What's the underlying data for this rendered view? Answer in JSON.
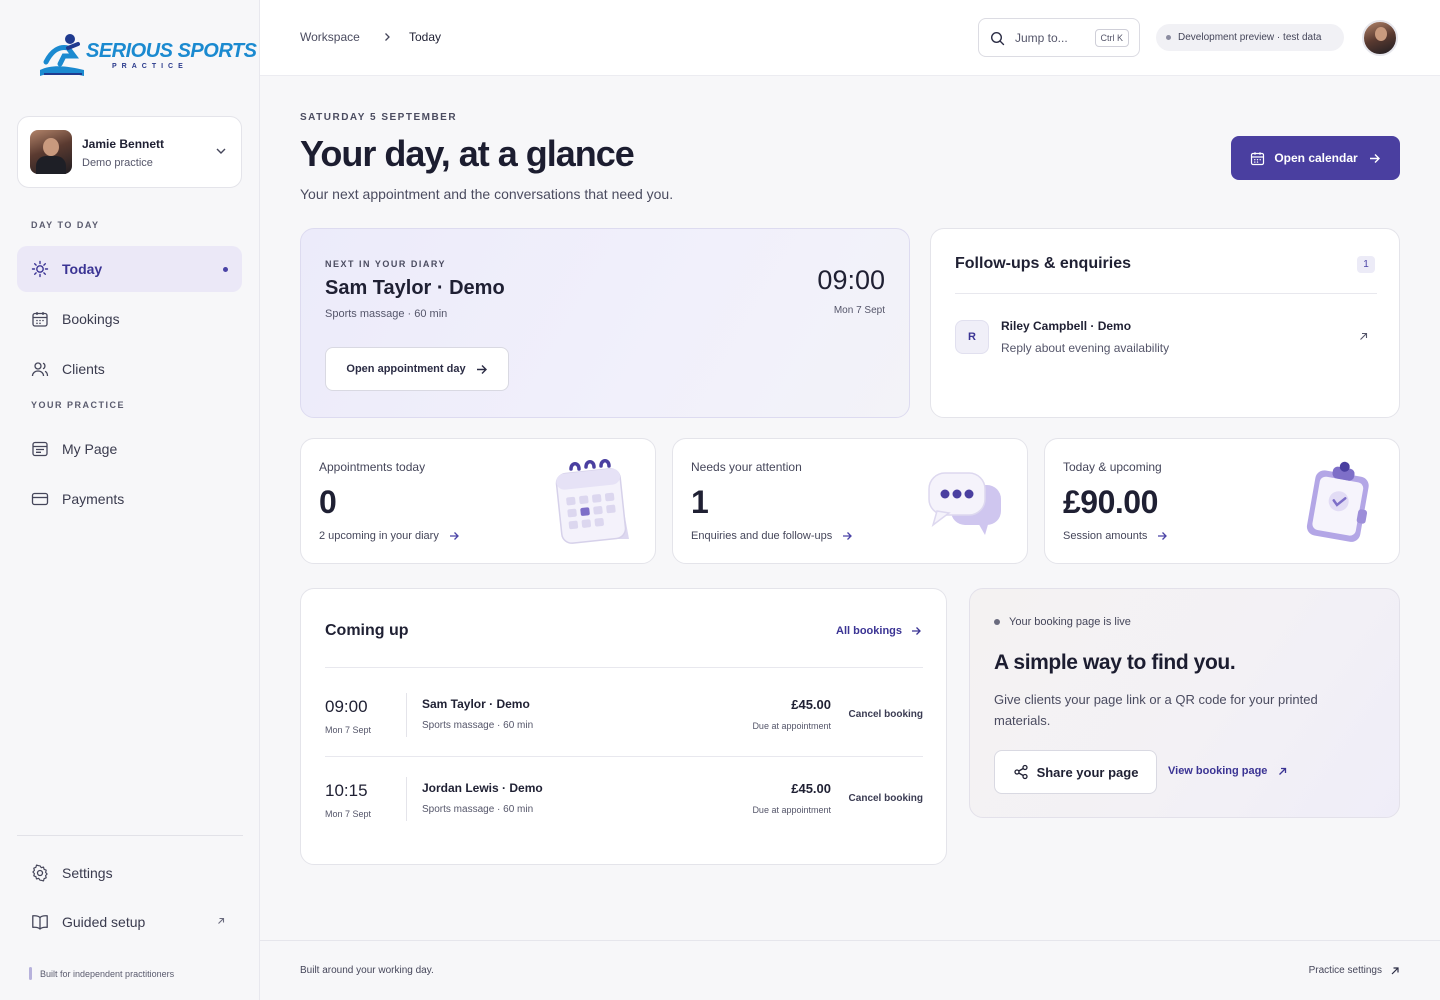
{
  "brand": {
    "name": "SERIOUS SPORTS",
    "tagline": "PRACTICE"
  },
  "user": {
    "name": "Jamie Bennett",
    "subtitle": "Demo practice"
  },
  "sidebar": {
    "section_day": "DAY TO DAY",
    "section_practice": "YOUR PRACTICE",
    "items": [
      {
        "label": "Today",
        "icon": "sun-icon",
        "active": true
      },
      {
        "label": "Bookings",
        "icon": "calendar-icon"
      },
      {
        "label": "Clients",
        "icon": "users-icon"
      },
      {
        "label": "My Page",
        "icon": "page-icon"
      },
      {
        "label": "Payments",
        "icon": "card-icon"
      }
    ],
    "settings": "Settings",
    "guided_setup": "Guided setup",
    "footer": "Built for independent practitioners"
  },
  "topbar": {
    "breadcrumb": [
      "Workspace",
      "Today"
    ],
    "search_placeholder": "Jump to...",
    "search_shortcut": "Ctrl K",
    "dev_badge": "Development preview · test data"
  },
  "header": {
    "date": "SATURDAY 5 SEPTEMBER",
    "title": "Your day, at a glance",
    "subtitle": "Your next appointment and the conversations that need you.",
    "primary_button": "Open calendar"
  },
  "next_appointment": {
    "eyebrow": "NEXT IN YOUR DIARY",
    "client": "Sam Taylor · Demo",
    "service": "Sports massage · 60 min",
    "time": "09:00",
    "date": "Mon 7 Sept",
    "button": "Open appointment day"
  },
  "followups": {
    "title": "Follow-ups & enquiries",
    "count": "1",
    "items": [
      {
        "initial": "R",
        "name": "Riley Campbell · Demo",
        "message": "Reply about evening availability"
      }
    ]
  },
  "stats": [
    {
      "label": "Appointments today",
      "value": "0",
      "link": "2 upcoming in your diary",
      "illustration": "calendar-illustration"
    },
    {
      "label": "Needs your attention",
      "value": "1",
      "link": "Enquiries and due follow-ups",
      "illustration": "chat-illustration"
    },
    {
      "label": "Today & upcoming",
      "value": "£90.00",
      "link": "Session amounts",
      "illustration": "clipboard-illustration"
    }
  ],
  "coming_up": {
    "title": "Coming up",
    "all_link": "All bookings",
    "rows": [
      {
        "time": "09:00",
        "date": "Mon 7 Sept",
        "client": "Sam Taylor · Demo",
        "service": "Sports massage · 60 min",
        "price": "£45.00",
        "due": "Due at appointment",
        "action": "Cancel booking"
      },
      {
        "time": "10:15",
        "date": "Mon 7 Sept",
        "client": "Jordan Lewis · Demo",
        "service": "Sports massage · 60 min",
        "price": "£45.00",
        "due": "Due at appointment",
        "action": "Cancel booking"
      }
    ]
  },
  "booking_page": {
    "status": "Your booking page is live",
    "title": "A simple way to find you.",
    "text": "Give clients your page link or a QR code for your printed materials.",
    "share_button": "Share your page",
    "view_link": "View booking page"
  },
  "footer": {
    "left": "Built around your working day.",
    "right": "Practice settings"
  },
  "colors": {
    "accent": "#4a3fa0",
    "accent_soft": "#ebe8f7",
    "brand_blue": "#1b8ad0"
  }
}
